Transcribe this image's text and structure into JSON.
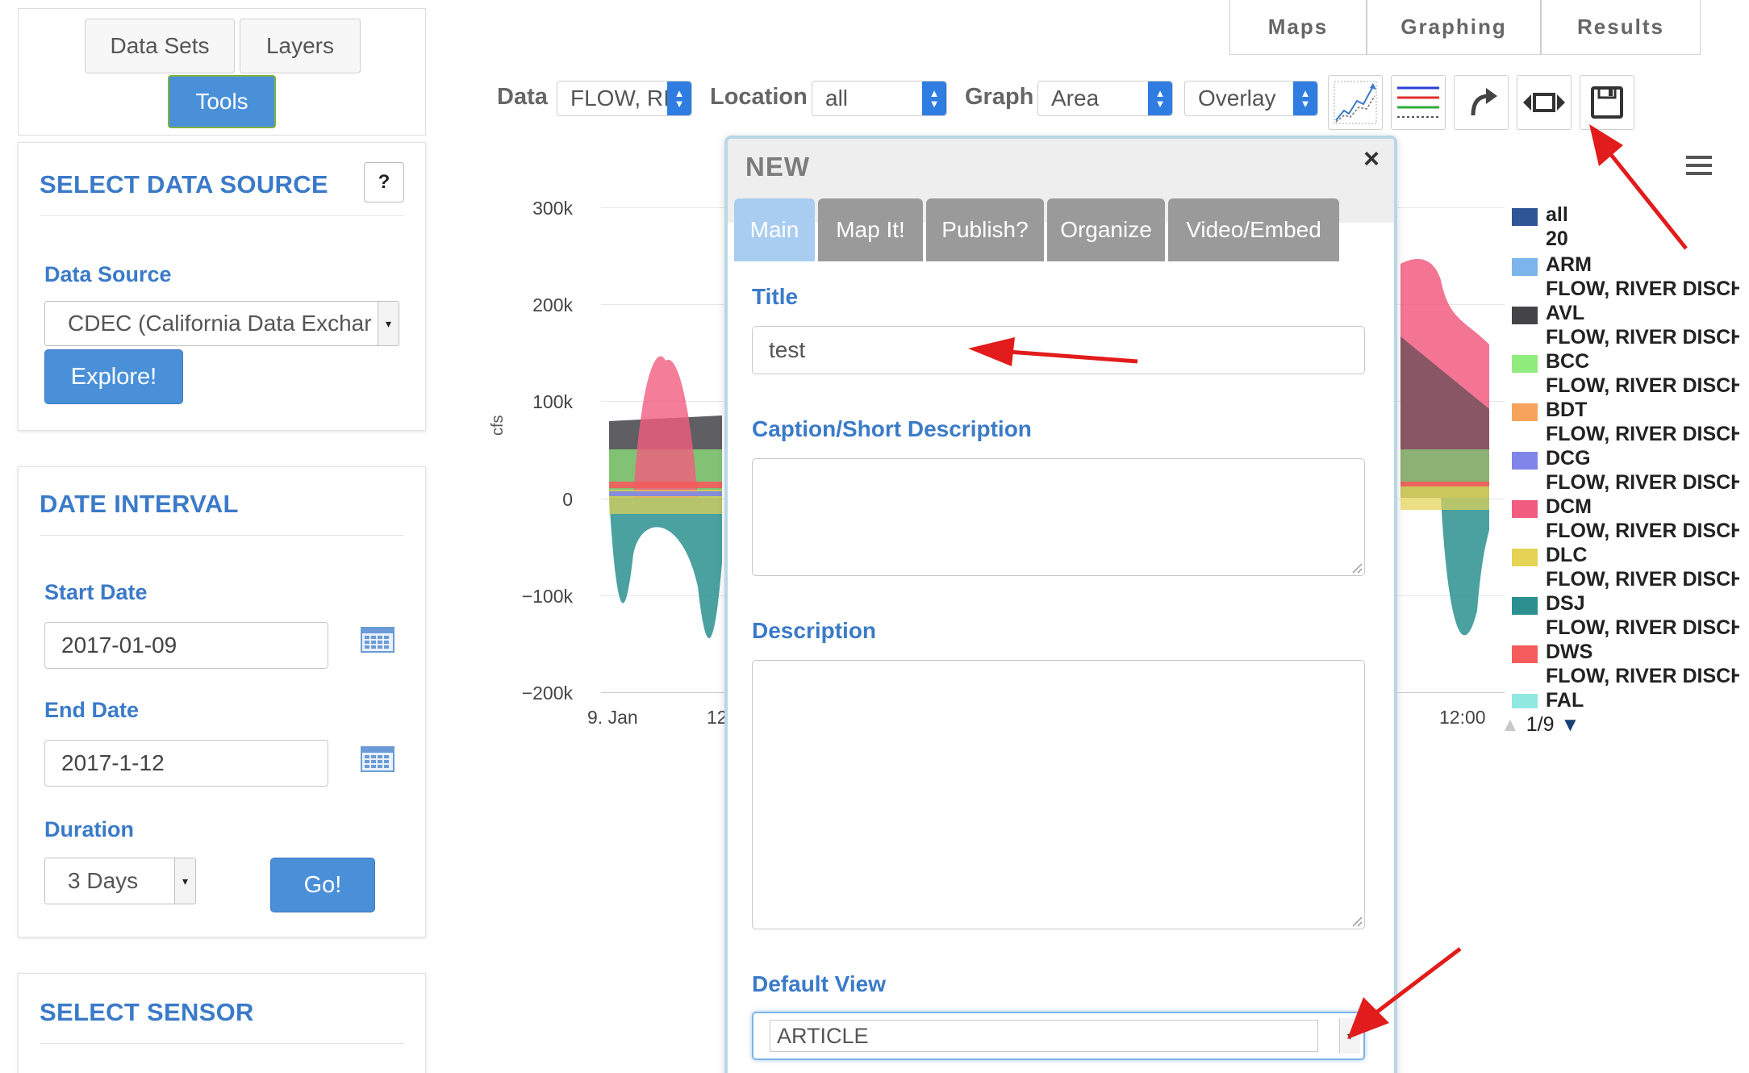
{
  "nav": {
    "datasets_label": "Data Sets",
    "layers_label": "Layers",
    "tools_label": "Tools"
  },
  "top_tabs": [
    "Maps",
    "Graphing",
    "Results"
  ],
  "select_data_source": {
    "title": "SELECT DATA SOURCE",
    "help_label": "?",
    "data_source_label": "Data Source",
    "data_source_value": "CDEC (California Data Exchar",
    "explore_label": "Explore!"
  },
  "date_interval": {
    "title": "DATE INTERVAL",
    "start_label": "Start Date",
    "start_value": "2017-01-09",
    "end_label": "End Date",
    "end_value": "2017-1-12",
    "duration_label": "Duration",
    "duration_value": "3 Days",
    "go_label": "Go!"
  },
  "select_sensor": {
    "title": "SELECT SENSOR"
  },
  "toolbar": {
    "data_label": "Data",
    "data_value": "FLOW, RI",
    "location_label": "Location",
    "location_value": "all",
    "graph_label": "Graph",
    "graph_value": "Area",
    "overlay_value": "Overlay"
  },
  "chart": {
    "y_ticks": [
      "300k",
      "200k",
      "100k",
      "0",
      "−100k",
      "−200k"
    ],
    "x_ticks": [
      "9. Jan",
      "12",
      "12:00"
    ],
    "ylabel_fragment": "cfs",
    "legend": {
      "header_all": "all",
      "header_num": "20",
      "items": [
        {
          "code": "ARM",
          "name": "FLOW, RIVER DISCHARGE",
          "color": "#7cb5ec"
        },
        {
          "code": "AVL",
          "name": "FLOW, RIVER DISCHARGE",
          "color": "#434348"
        },
        {
          "code": "BCC",
          "name": "FLOW, RIVER DISCHARGE",
          "color": "#90ed7d"
        },
        {
          "code": "BDT",
          "name": "FLOW, RIVER DISCHARGE",
          "color": "#f7a35c"
        },
        {
          "code": "DCG",
          "name": "FLOW, RIVER DISCHARGE",
          "color": "#8085e9"
        },
        {
          "code": "DCM",
          "name": "FLOW, RIVER DISCHARGE",
          "color": "#f15c80"
        },
        {
          "code": "DLC",
          "name": "FLOW, RIVER DISCHARGE",
          "color": "#e4d354"
        },
        {
          "code": "DSJ",
          "name": "FLOW, RIVER DISCHARGE",
          "color": "#2b908f"
        },
        {
          "code": "DWS",
          "name": "FLOW, RIVER DISCHARGE",
          "color": "#f45b5b"
        },
        {
          "code": "FAL",
          "name": "",
          "color": "#91e8e1"
        }
      ],
      "all_color": "#2f5597",
      "pager": "1/9"
    }
  },
  "modal": {
    "title": "NEW",
    "close": "×",
    "tabs": [
      "Main",
      "Map It!",
      "Publish?",
      "Organize",
      "Video/Embed"
    ],
    "title_label": "Title",
    "title_value": "test",
    "caption_label": "Caption/Short Description",
    "description_label": "Description",
    "default_view_label": "Default View",
    "default_view_value": "ARTICLE"
  }
}
